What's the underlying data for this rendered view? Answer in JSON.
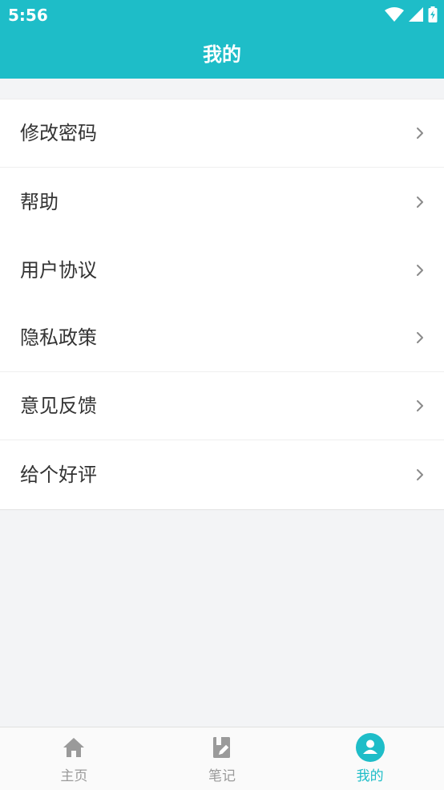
{
  "status_bar": {
    "time": "5:56"
  },
  "header": {
    "title": "我的"
  },
  "menu": {
    "items": [
      {
        "label": "修改密码"
      },
      {
        "label": "帮助"
      },
      {
        "label": "用户协议"
      },
      {
        "label": "隐私政策"
      },
      {
        "label": "意见反馈"
      },
      {
        "label": "给个好评"
      }
    ]
  },
  "tabbar": {
    "tabs": [
      {
        "label": "主页",
        "icon": "home-icon",
        "active": false
      },
      {
        "label": "笔记",
        "icon": "notebook-icon",
        "active": false
      },
      {
        "label": "我的",
        "icon": "user-icon",
        "active": true
      }
    ]
  },
  "colors": {
    "accent": "#1ebdc8",
    "inactive": "#9a9a9a",
    "background": "#f3f4f6"
  }
}
